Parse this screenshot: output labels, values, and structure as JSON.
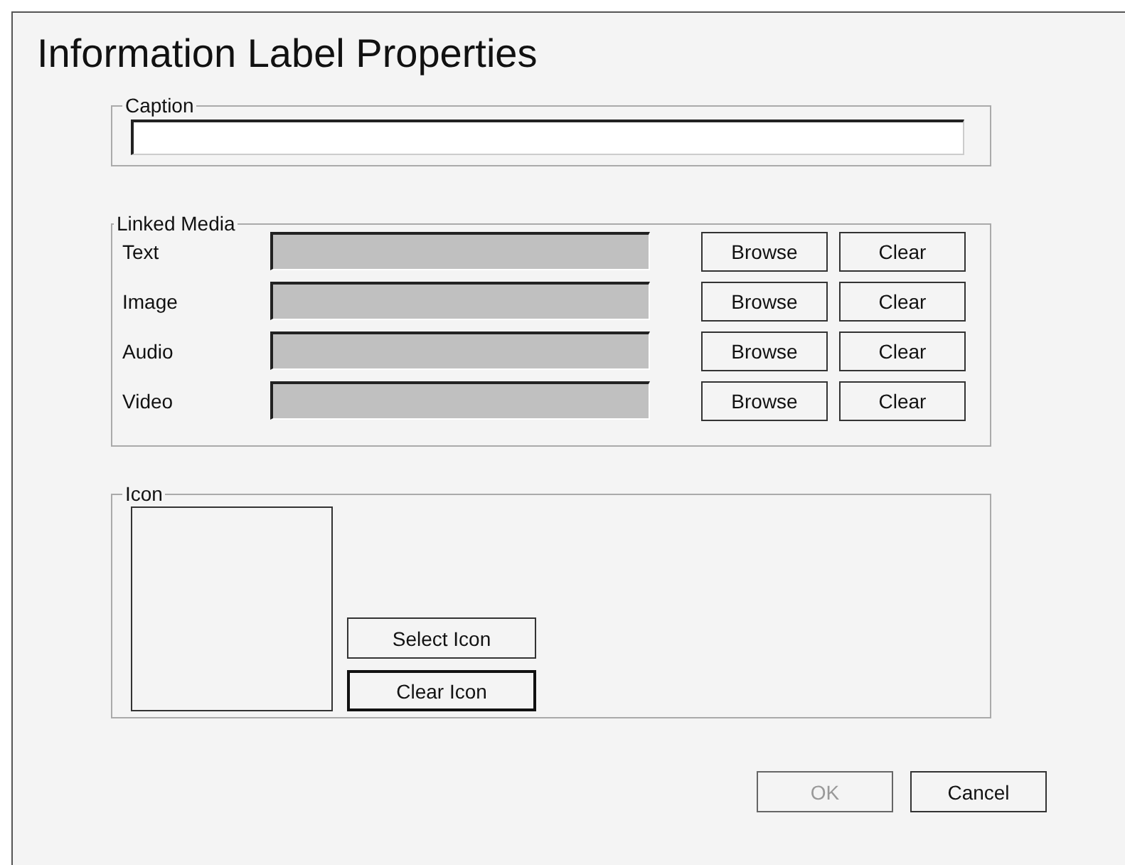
{
  "title": "Information Label Properties",
  "caption": {
    "label": "Caption"
  },
  "linked_media": {
    "label": "Linked Media",
    "rows": [
      {
        "label": "Text",
        "disabled": true,
        "browse": "Browse",
        "clear": "Clear"
      },
      {
        "label": "Image",
        "disabled": true,
        "browse": "Browse",
        "clear": "Clear"
      },
      {
        "label": "Audio",
        "disabled": true,
        "browse": "Browse",
        "clear": "Clear"
      },
      {
        "label": "Video",
        "disabled": true,
        "browse": "Browse",
        "clear": "Clear"
      }
    ]
  },
  "icon": {
    "label": "Icon",
    "buttons": [
      {
        "label": "Select Icon",
        "default": false
      },
      {
        "label": "Clear Icon",
        "default": true
      }
    ]
  },
  "footer": [
    {
      "label": "OK",
      "disabled": true
    },
    {
      "label": "Cancel",
      "disabled": false
    }
  ]
}
